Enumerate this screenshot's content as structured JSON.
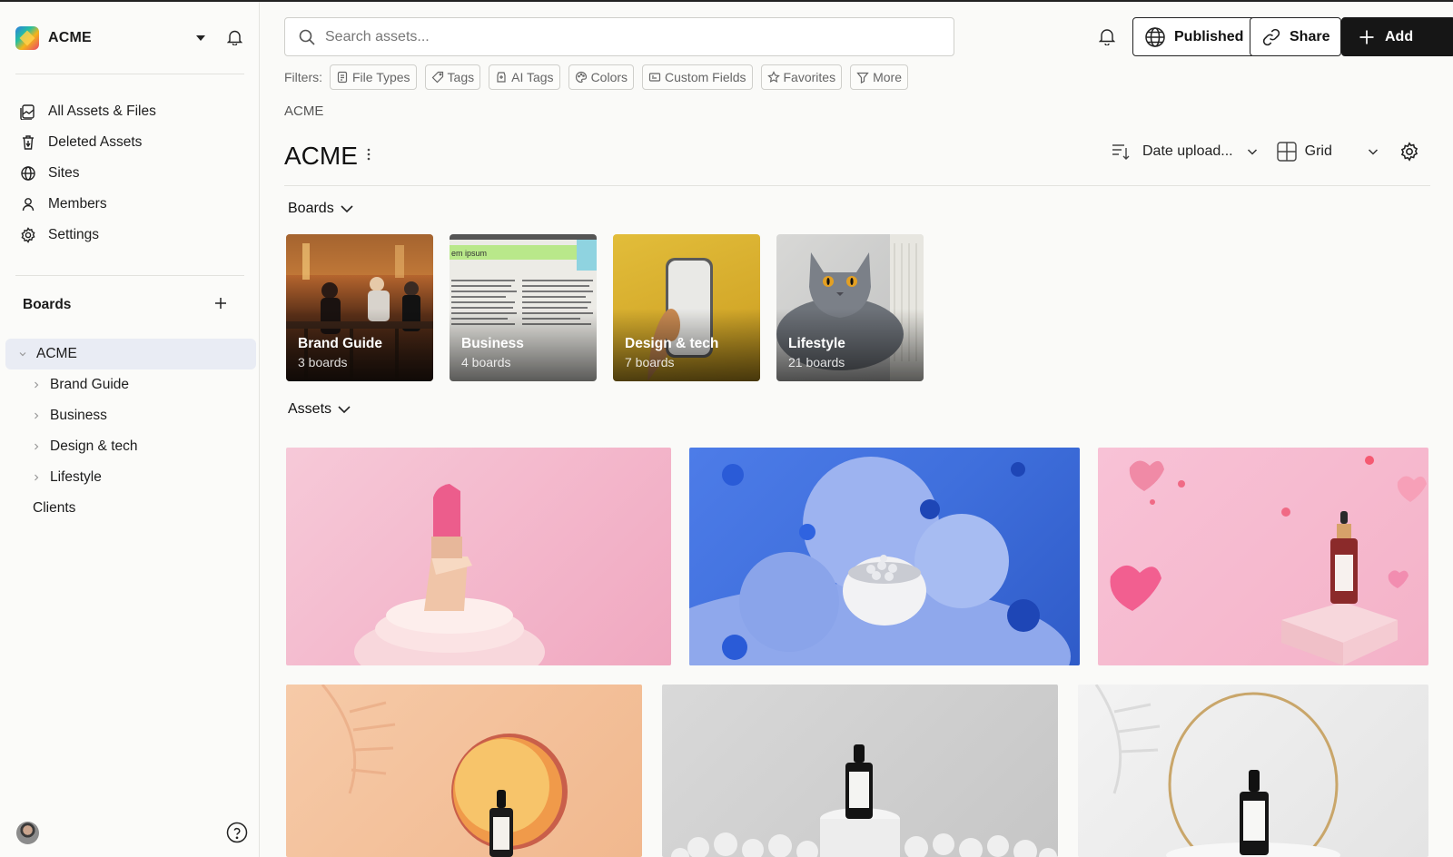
{
  "org": {
    "name": "ACME"
  },
  "nav": [
    {
      "label": "All Assets & Files",
      "icon": "assets-icon"
    },
    {
      "label": "Deleted Assets",
      "icon": "trash-icon"
    },
    {
      "label": "Sites",
      "icon": "globe-icon"
    },
    {
      "label": "Members",
      "icon": "person-icon"
    },
    {
      "label": "Settings",
      "icon": "gear-icon"
    }
  ],
  "sidebar_boards": {
    "heading": "Boards",
    "tree": [
      {
        "label": "ACME",
        "expanded": true,
        "active": true
      },
      {
        "label": "Brand Guide"
      },
      {
        "label": "Business"
      },
      {
        "label": "Design & tech"
      },
      {
        "label": "Lifestyle"
      },
      {
        "label": "Clients"
      }
    ]
  },
  "search": {
    "placeholder": "Search assets..."
  },
  "header_buttons": {
    "published": "Published",
    "share": "Share",
    "add": "Add"
  },
  "filters": {
    "label": "Filters:",
    "chips": [
      "File Types",
      "Tags",
      "AI Tags",
      "Colors",
      "Custom Fields",
      "Favorites",
      "More"
    ]
  },
  "breadcrumb": "ACME",
  "page_title": "ACME",
  "sort": {
    "value": "Date upload...",
    "view": "Grid"
  },
  "boards_section": {
    "heading": "Boards",
    "cards": [
      {
        "name": "Brand Guide",
        "count": "3 boards"
      },
      {
        "name": "Business",
        "count": "4 boards"
      },
      {
        "name": "Design & tech",
        "count": "7 boards"
      },
      {
        "name": "Lifestyle",
        "count": "21 boards"
      }
    ]
  },
  "assets_section": {
    "heading": "Assets"
  },
  "colors": {
    "accent_dark": "#161616",
    "active_row": "#e9ecf4"
  }
}
